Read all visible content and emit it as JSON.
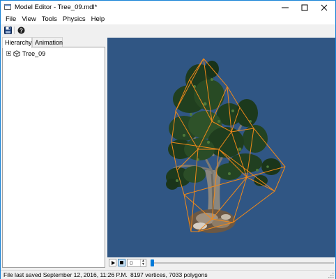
{
  "window": {
    "title": "Model Editor - Tree_09.mdl*",
    "controls": {
      "minimize": "minimize-icon",
      "maximize": "maximize-icon",
      "close": "close-icon"
    }
  },
  "menu": {
    "items": [
      "File",
      "View",
      "Tools",
      "Physics",
      "Help"
    ]
  },
  "toolbar": {
    "buttons": [
      {
        "name": "save",
        "icon": "floppy-disk-icon"
      },
      {
        "name": "help",
        "icon": "question-mark-icon"
      }
    ]
  },
  "hierarchy": {
    "tabs": [
      "Hierarchy",
      "Animation"
    ],
    "active_tab": "Hierarchy",
    "nodes": [
      {
        "label": "Tree_09",
        "icon": "cube-icon",
        "expander": "plus"
      }
    ]
  },
  "viewport": {
    "background": "#305684",
    "wireframe_color": "#f0891a",
    "content": "tree-model"
  },
  "playback": {
    "play_icon": "play-icon",
    "stop_icon": "stop-icon",
    "frame_value": "0",
    "timeline_position": 0
  },
  "status": {
    "saved": "File last saved September 12, 2016, 11:26 P.M.",
    "stats": "8197 vertices, 7033 polygons"
  },
  "colors": {
    "accent": "#1883d7",
    "selection": "#cce4f7"
  }
}
